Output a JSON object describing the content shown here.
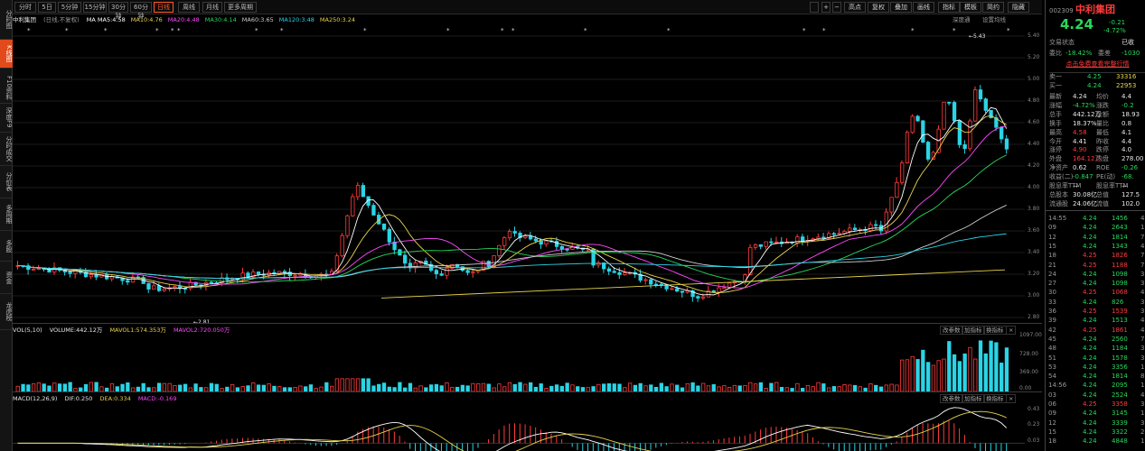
{
  "left_nav": [
    "分时图",
    "K线图",
    "F10资料",
    "深度F9",
    "分时成交",
    "分价表",
    "多周期",
    "多股",
    "资金",
    "龙虎榜"
  ],
  "periods": [
    "分时",
    "5日",
    "5分钟",
    "15分钟",
    "30分钟",
    "60分钟",
    "日线",
    "周线",
    "月线",
    "更多周期"
  ],
  "tools": [
    "高点",
    "复权",
    "叠加",
    "画线",
    "指标",
    "模板",
    "简约",
    "隐藏"
  ],
  "stock_header": {
    "name": "中利集团",
    "adj": "(日线,不复权)"
  },
  "ma_legend": [
    {
      "text": "MA  MA5:4.58",
      "color": "#ffffff"
    },
    {
      "text": "MA10:4.76",
      "color": "#e8d34b"
    },
    {
      "text": "MA20:4.48",
      "color": "#ff4bff"
    },
    {
      "text": "MA30:4.14",
      "color": "#27d95b"
    },
    {
      "text": "MA60:3.65",
      "color": "#cfcfcf"
    },
    {
      "text": "MA120:3.48",
      "color": "#2ad4e6"
    },
    {
      "text": "MA250:3.24",
      "color": "#e8d34b"
    }
  ],
  "top_right_links": {
    "deep": "深度通",
    "settings": "设置均线"
  },
  "price_axis": [
    "5.40",
    "5.20",
    "5.00",
    "4.80",
    "4.60",
    "4.40",
    "4.20",
    "4.00",
    "3.80",
    "3.60",
    "3.40",
    "3.20",
    "3.00",
    "2.80"
  ],
  "annotations": {
    "high": "5.43",
    "low": "2.81"
  },
  "vol_legend": {
    "title": "VOL(5,10)",
    "volume": "VOLUME:442.12万",
    "mavol1": "MAVOL1:574.353万",
    "mavol2": "MAVOL2:720.050万"
  },
  "vol_axis": [
    "1097.00",
    "728.00",
    "369.00",
    "0.00"
  ],
  "macd_legend": {
    "title": "MACD(12,26,9)",
    "dif": "DIF:0.250",
    "dea": "DEA:0.334",
    "macd": "MACD:-0.169"
  },
  "macd_axis": [
    "0.43",
    "0.23",
    "0.03"
  ],
  "panel_buttons": [
    "改参数",
    "加指标",
    "换指标"
  ],
  "quote": {
    "code": "002309",
    "name": "中利集团",
    "price": "4.24",
    "change": "-0.21",
    "change_pct": "-4.72%",
    "trade_status_label": "交易状态",
    "trade_status": "已收",
    "weibi_label": "委比",
    "weibi": "-18.42%",
    "weicha_label": "委差",
    "weicha": "-1030",
    "promo": "点击免费查看完整行情",
    "sell1": {
      "label": "卖一",
      "price": "4.25",
      "vol": "33316"
    },
    "buy1": {
      "label": "买一",
      "price": "4.24",
      "vol": "22953"
    },
    "stats": [
      [
        "最新",
        "4.24",
        "均价",
        "4.4"
      ],
      [
        "涨幅",
        "-4.72%",
        "涨跌",
        "-0.2"
      ],
      [
        "总手",
        "442.12万",
        "金额",
        "18.93"
      ],
      [
        "换手",
        "18.37%",
        "量比",
        "0.8"
      ],
      [
        "最高",
        "4.58",
        "最低",
        "4.1"
      ],
      [
        "今开",
        "4.41",
        "昨收",
        "4.4"
      ],
      [
        "涨停",
        "4.90",
        "跌停",
        "4.0"
      ],
      [
        "外盘",
        "164.12万",
        "内盘",
        "278.00"
      ],
      [
        "净资产",
        "0.62",
        "ROE",
        "-0.26"
      ],
      [
        "收益(二)",
        "-0.847",
        "PE(动)",
        "-68."
      ],
      [
        "股息率TTM",
        "—",
        "股息率TTM",
        "—"
      ],
      [
        "总股本",
        "30.08亿",
        "总值",
        "127.5"
      ],
      [
        "流通股",
        "24.06亿",
        "流值",
        "102.0"
      ]
    ],
    "ticks": [
      [
        "14:55",
        "4.24",
        "1456",
        "4"
      ],
      [
        "09",
        "4.24",
        "2643",
        "1"
      ],
      [
        "12",
        "4.24",
        "1814",
        "7"
      ],
      [
        "15",
        "4.24",
        "1343",
        "4"
      ],
      [
        "18",
        "4.25",
        "1826",
        "7"
      ],
      [
        "21",
        "4.25",
        "1188",
        "7"
      ],
      [
        "24",
        "4.24",
        "1098",
        "3"
      ],
      [
        "27",
        "4.24",
        "1098",
        "3"
      ],
      [
        "30",
        "4.25",
        "1068",
        "4"
      ],
      [
        "33",
        "4.24",
        "826",
        "3"
      ],
      [
        "36",
        "4.25",
        "1539",
        "3"
      ],
      [
        "39",
        "4.24",
        "1513",
        "4"
      ],
      [
        "42",
        "4.25",
        "1861",
        "4"
      ],
      [
        "45",
        "4.24",
        "2560",
        "7"
      ],
      [
        "48",
        "4.24",
        "1184",
        "3"
      ],
      [
        "51",
        "4.24",
        "1578",
        "3"
      ],
      [
        "53",
        "4.24",
        "3356",
        "1"
      ],
      [
        "54",
        "4.24",
        "1814",
        "8"
      ],
      [
        "14:56",
        "4.24",
        "2095",
        "1"
      ],
      [
        "03",
        "4.24",
        "2524",
        "4"
      ],
      [
        "06",
        "4.25",
        "3358",
        "3"
      ],
      [
        "09",
        "4.24",
        "3145",
        "1"
      ],
      [
        "12",
        "4.24",
        "3339",
        "3"
      ],
      [
        "15",
        "4.24",
        "3322",
        "2"
      ],
      [
        "18",
        "4.24",
        "4848",
        "1"
      ]
    ]
  }
}
